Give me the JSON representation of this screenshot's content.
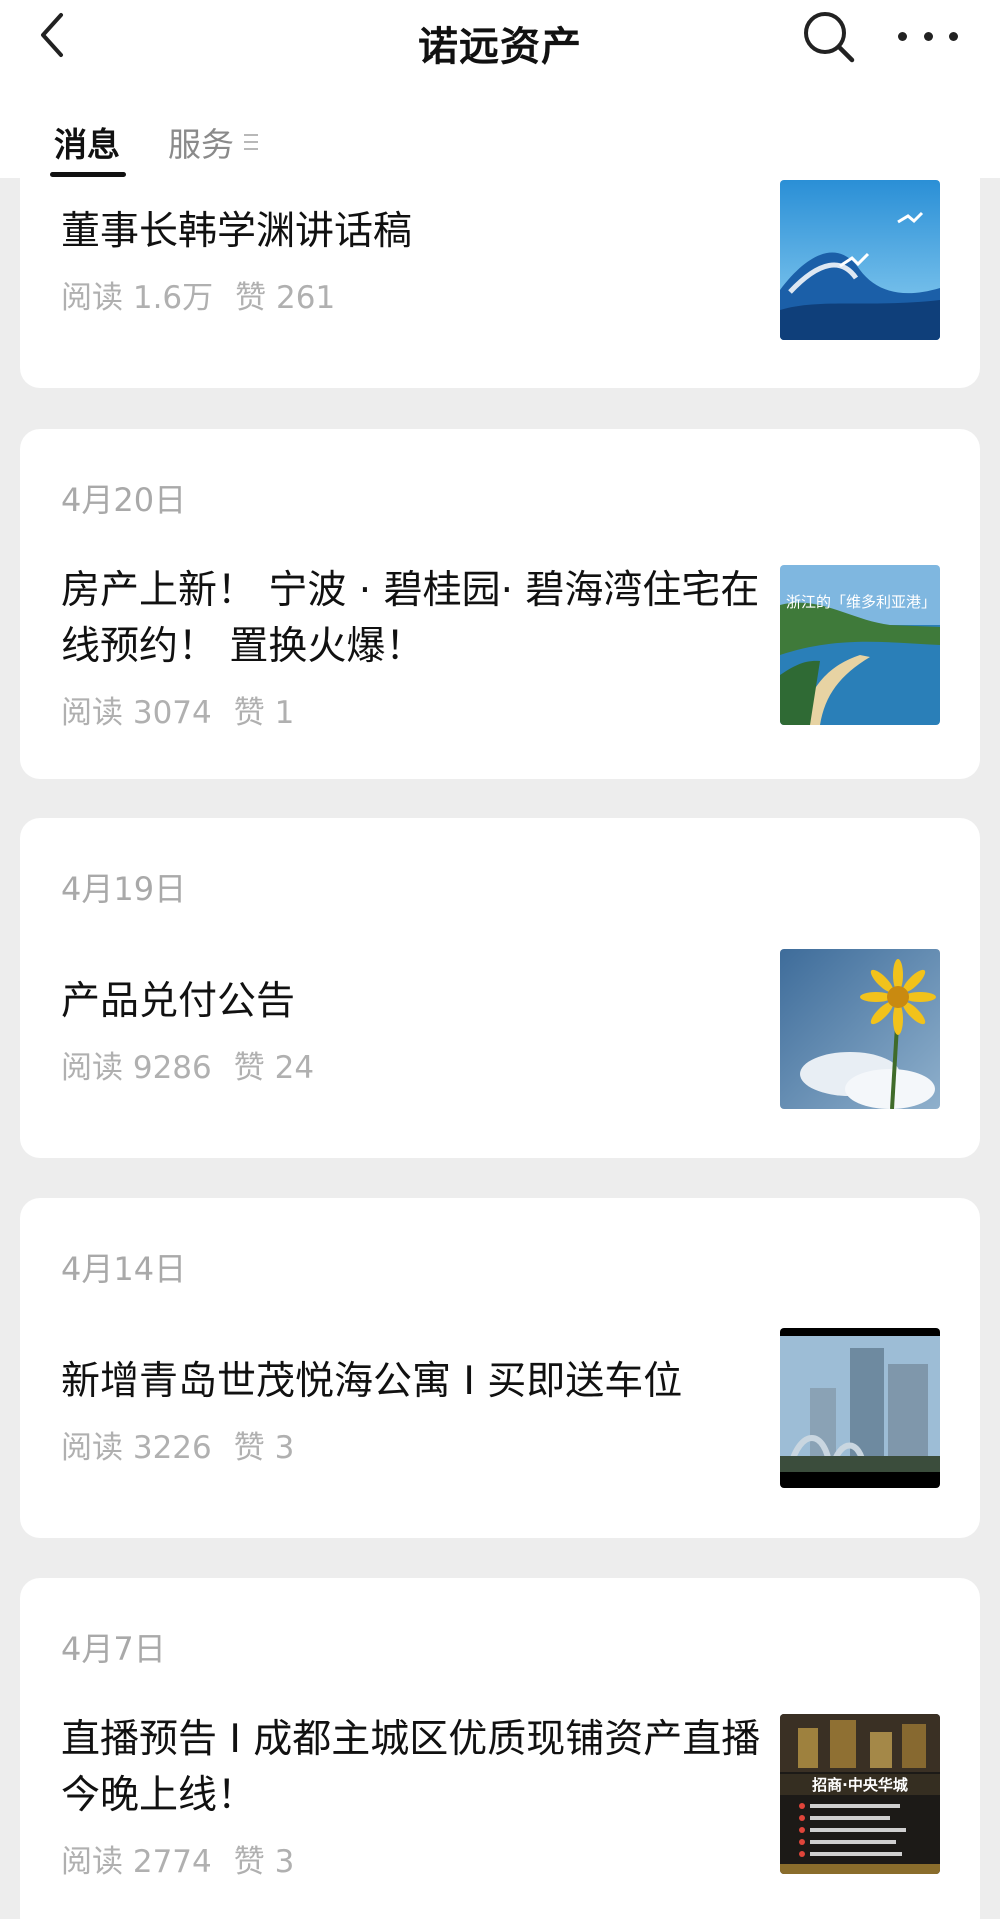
{
  "header": {
    "title": "诺远资产",
    "back_icon": "chevron-left-icon",
    "search_icon": "search-icon",
    "more_icon": "more-horizontal-icon"
  },
  "tabs": [
    {
      "label": "消息",
      "active": true
    },
    {
      "label": "服务",
      "active": false
    }
  ],
  "articles": [
    {
      "date": "",
      "title": "董事长韩学渊讲话稿",
      "reads": "阅读 1.6万",
      "likes": "赞 261",
      "thumb": "ocean-wave-seagulls"
    },
    {
      "date": "4月20日",
      "title": "房产上新！ 宁波 · 碧桂园· 碧海湾住宅在线预约！ 置换火爆！",
      "reads": "阅读 3074",
      "likes": "赞 1",
      "thumb": "coastline-bay",
      "thumb_caption": "浙江的「维多利亚港」"
    },
    {
      "date": "4月19日",
      "title": "产品兑付公告",
      "reads": "阅读 9286",
      "likes": "赞 24",
      "thumb": "sunflower-sky"
    },
    {
      "date": "4月14日",
      "title": "新增青岛世茂悦海公寓 I 买即送车位",
      "reads": "阅读 3226",
      "likes": "赞 3",
      "thumb": "city-towers"
    },
    {
      "date": "4月7日",
      "title": "直播预告 I 成都主城区优质现铺资产直播今晚上线！",
      "reads": "阅读 2774",
      "likes": "赞 3",
      "thumb": "property-poster",
      "thumb_caption": "招商·中央华城"
    }
  ]
}
